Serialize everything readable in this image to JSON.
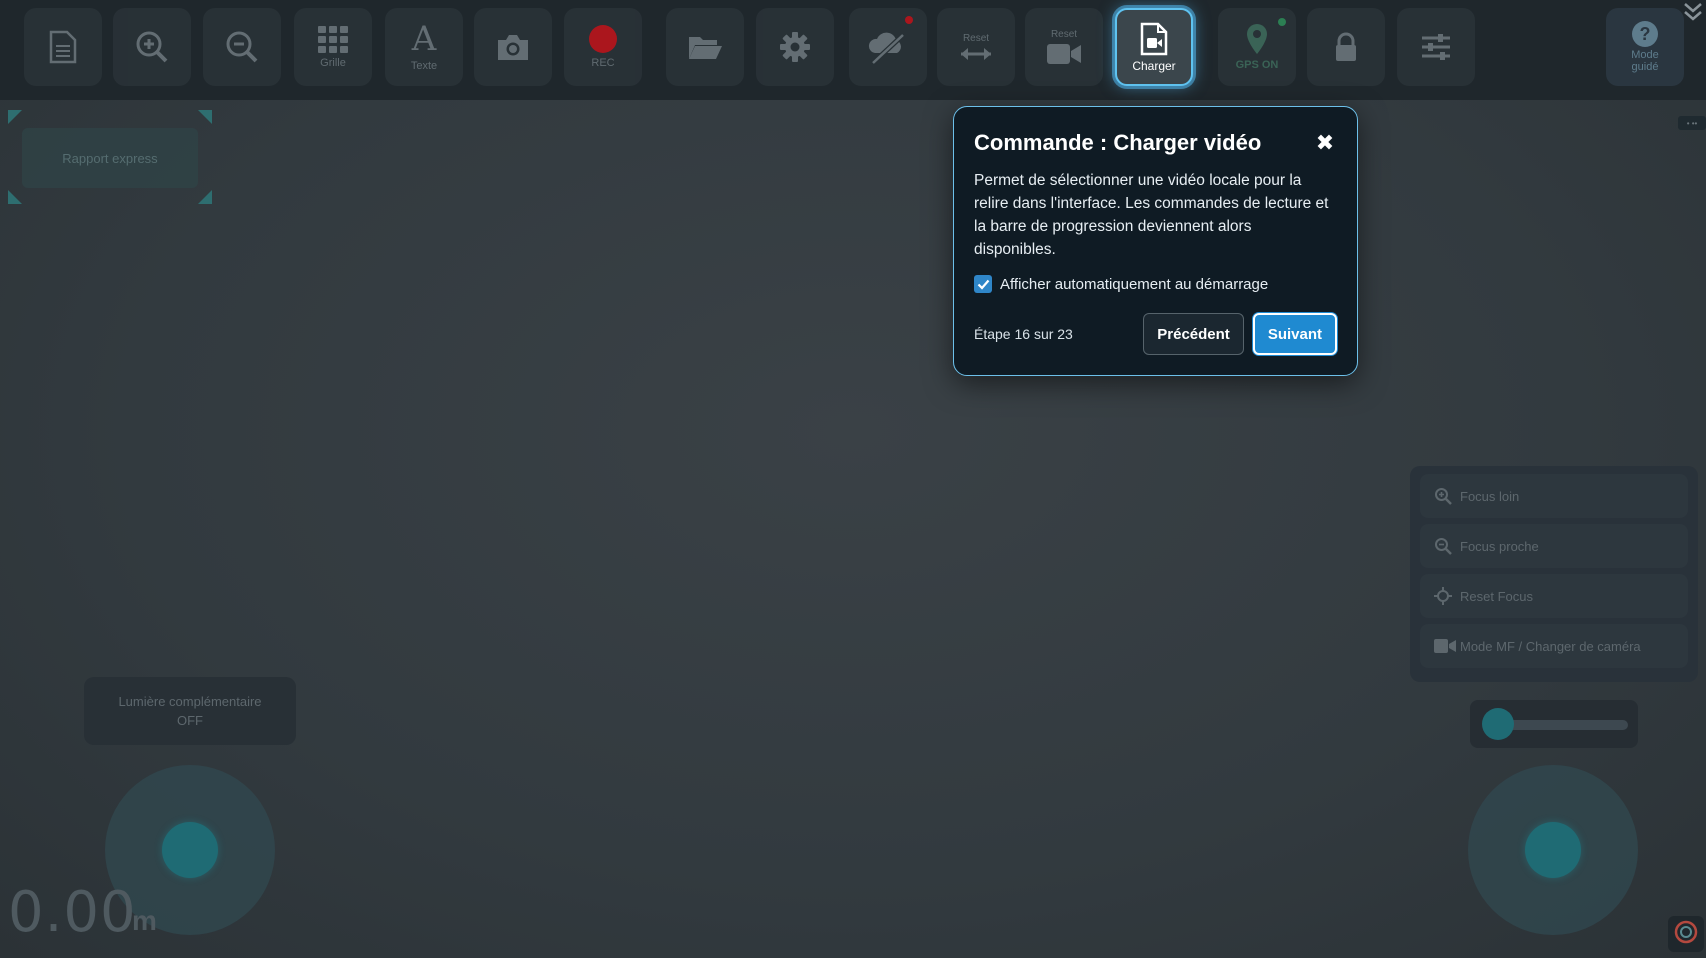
{
  "toolbar": {
    "buttons": [
      {
        "icon": "document-icon",
        "label": ""
      },
      {
        "icon": "zoom-in-icon",
        "label": ""
      },
      {
        "icon": "zoom-out-icon",
        "label": ""
      },
      {
        "icon": "grid-icon",
        "label": "Grille"
      },
      {
        "icon": "text-icon",
        "label": "Texte"
      },
      {
        "icon": "camera-icon",
        "label": ""
      },
      {
        "icon": "record-icon",
        "label": "REC"
      },
      {
        "icon": "folder-icon",
        "label": ""
      },
      {
        "icon": "gear-icon",
        "label": ""
      },
      {
        "icon": "cloud-off-icon",
        "label": ""
      },
      {
        "icon": "reset-arrows-icon",
        "top_label": "Reset",
        "label": ""
      },
      {
        "icon": "reset-video-icon",
        "top_label": "Reset",
        "label": ""
      },
      {
        "icon": "video-file-icon",
        "label": "Charger"
      },
      {
        "icon": "gps-pin-icon",
        "label": "GPS ON"
      },
      {
        "icon": "lock-icon",
        "label": ""
      },
      {
        "icon": "sliders-icon",
        "label": ""
      }
    ],
    "help": {
      "icon": "question-icon",
      "label_line1": "Mode",
      "label_line2": "guidé"
    }
  },
  "report": {
    "label": "Rapport express"
  },
  "light": {
    "line1": "Lumière complémentaire",
    "line2": "OFF"
  },
  "speed": {
    "value": "0.00",
    "unit": "m"
  },
  "focus_panel": {
    "items": [
      {
        "icon": "zoom-in-icon",
        "label": "Focus loin"
      },
      {
        "icon": "zoom-out-icon",
        "label": "Focus proche"
      },
      {
        "icon": "crosshair-icon",
        "label": "Reset Focus"
      },
      {
        "icon": "video-camera-icon",
        "label": "Mode MF / Changer de caméra"
      }
    ]
  },
  "mini_right": {
    "label": "• ••"
  },
  "dialog": {
    "title": "Commande : Charger vidéo",
    "body": "Permet de sélectionner une vidéo locale pour la relire dans l'interface. Les commandes de lecture et la barre de progression deviennent alors disponibles.",
    "checkbox_label": "Afficher automatiquement au démarrage",
    "checkbox_checked": true,
    "step": "Étape 16 sur 23",
    "prev_label": "Précédent",
    "next_label": "Suivant",
    "close_symbol": "✖"
  },
  "colors": {
    "accent": "#1f8ad1",
    "border_glow": "#6cc0ea",
    "record": "#c4141b",
    "joystick": "#1f6b74"
  }
}
